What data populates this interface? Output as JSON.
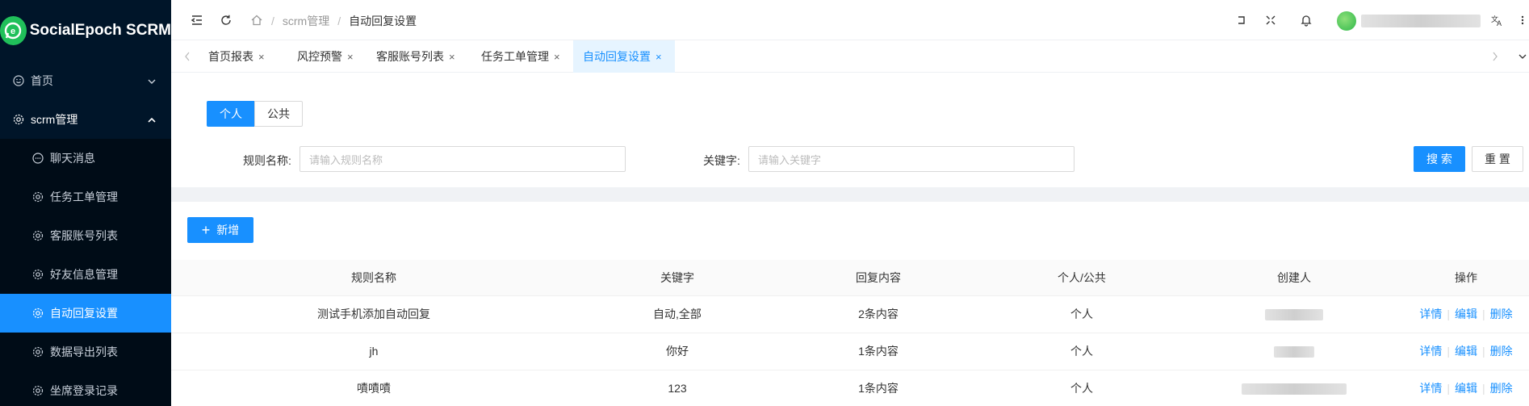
{
  "app": {
    "title": "SocialEpoch SCRM"
  },
  "sidebar": {
    "items": [
      {
        "label": "首页",
        "icon": "smile-icon"
      },
      {
        "label": "scrm管理",
        "icon": "gear-icon"
      },
      {
        "label": "聊天消息",
        "icon": "chat-icon"
      },
      {
        "label": "任务工单管理",
        "icon": "gear-icon"
      },
      {
        "label": "客服账号列表",
        "icon": "gear-icon"
      },
      {
        "label": "好友信息管理",
        "icon": "gear-icon"
      },
      {
        "label": "自动回复设置",
        "icon": "gear-icon",
        "active": true
      },
      {
        "label": "数据导出列表",
        "icon": "gear-icon"
      },
      {
        "label": "坐席登录记录",
        "icon": "gear-icon"
      }
    ]
  },
  "header": {
    "breadcrumb": [
      "scrm管理",
      "自动回复设置"
    ]
  },
  "tabs": [
    {
      "label": "首页报表"
    },
    {
      "label": "风控预警"
    },
    {
      "label": "客服账号列表"
    },
    {
      "label": "任务工单管理"
    },
    {
      "label": "自动回复设置",
      "active": true
    }
  ],
  "filter": {
    "seg_personal": "个人",
    "seg_public": "公共",
    "rule_name_label": "规则名称:",
    "rule_name_placeholder": "请输入规则名称",
    "keyword_label": "关键字:",
    "keyword_placeholder": "请输入关键字",
    "search_label": "搜 索",
    "reset_label": "重 置"
  },
  "toolbar": {
    "add_label": "新增"
  },
  "table": {
    "columns": [
      "规则名称",
      "关键字",
      "回复内容",
      "个人/公共",
      "创建人",
      "操作"
    ],
    "rows": [
      {
        "name": "测试手机添加自动回复",
        "keyword": "自动,全部",
        "reply": "2条内容",
        "scope": "个人"
      },
      {
        "name": "jh",
        "keyword": "你好",
        "reply": "1条内容",
        "scope": "个人"
      },
      {
        "name": "嘖嘖嘖",
        "keyword": "123",
        "reply": "1条内容",
        "scope": "个人"
      }
    ],
    "actions": {
      "detail": "详情",
      "edit": "编辑",
      "delete": "删除"
    }
  },
  "colors": {
    "primary": "#1890ff",
    "sidebar_bg": "#001529",
    "logo_green": "#20c05a"
  }
}
